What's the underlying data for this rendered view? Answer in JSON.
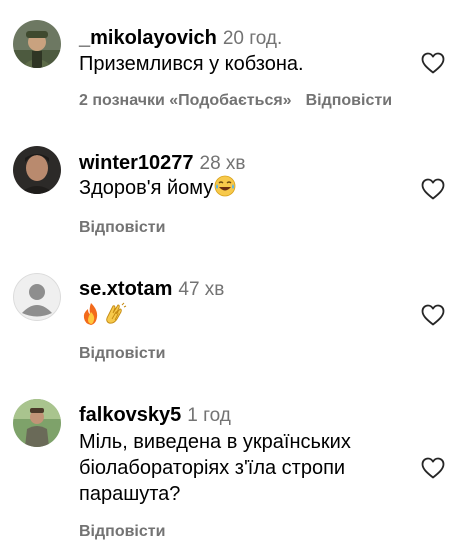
{
  "comments": [
    {
      "username": "_mikolayovich",
      "time": "20 год.",
      "text": "Приземлився у кобзона.",
      "likes": "2 позначки «Подобається»",
      "reply": "Відповісти",
      "avatar": "avatar-man-cap"
    },
    {
      "username": "winter10277",
      "time": "28 хв",
      "text": "Здоров'я йому",
      "emoji": [
        "tears-of-joy-emoji"
      ],
      "reply": "Відповісти",
      "avatar": "avatar-man-dark"
    },
    {
      "username": "se.xtotam",
      "time": "47 хв",
      "text": "",
      "emoji": [
        "fire-emoji",
        "clapping-hands-emoji"
      ],
      "reply": "Відповісти",
      "avatar": "avatar-default"
    },
    {
      "username": "falkovsky5",
      "time": "1 год",
      "text_lines": [
        "Міль, виведена в українських",
        "біолабораторіях з'їла стропи",
        "парашута?"
      ],
      "reply": "Відповісти",
      "avatar": "avatar-man-outdoor"
    }
  ],
  "colors": {
    "secondary_text": "#737373",
    "primary_text": "#000000",
    "heart_outline": "#262626",
    "default_avatar_bg": "#dbdbdb"
  }
}
